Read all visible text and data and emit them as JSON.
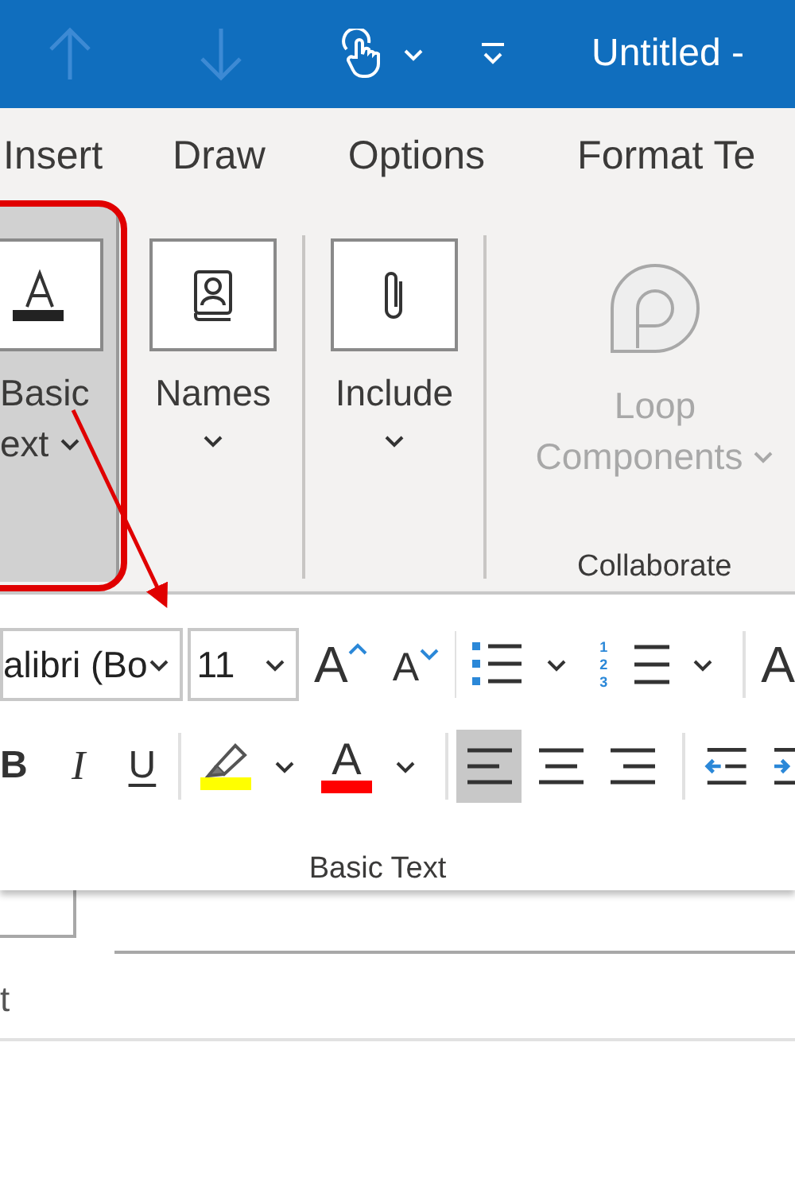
{
  "window": {
    "title": "Untitled -"
  },
  "quick_access": [
    {
      "kind": "up",
      "disabled": true
    },
    {
      "kind": "down",
      "disabled": true
    },
    {
      "kind": "touch",
      "disabled": false
    },
    {
      "kind": "customize",
      "disabled": false
    }
  ],
  "tabs": [
    {
      "label": "Insert"
    },
    {
      "label": "Draw"
    },
    {
      "label": "Options"
    },
    {
      "label": "Format Te"
    }
  ],
  "ribbon": {
    "buttons": [
      {
        "kind": "text",
        "lines": [
          "Basic",
          "ext"
        ],
        "selected": true,
        "disabled": false
      },
      {
        "kind": "names",
        "lines": [
          "Names"
        ],
        "selected": false,
        "disabled": false
      },
      {
        "kind": "include",
        "lines": [
          "Include"
        ],
        "selected": false,
        "disabled": false
      },
      {
        "kind": "loop",
        "lines": [
          "Loop",
          "Components"
        ],
        "selected": false,
        "disabled": true
      }
    ],
    "group_label": "Collaborate"
  },
  "basic_text_panel": {
    "row_1": [
      {
        "kind": "font",
        "value": "alibri (Bo"
      },
      {
        "kind": "size",
        "value": "11"
      },
      {
        "kind": "grow",
        "label": "A"
      },
      {
        "kind": "shrink",
        "label": "A"
      },
      {
        "kind": "separator"
      },
      {
        "kind": "bullets"
      },
      {
        "kind": "numbering",
        "numbers": [
          "1",
          "2",
          "3"
        ]
      },
      {
        "kind": "separator"
      },
      {
        "kind": "styles",
        "label": "A"
      }
    ],
    "row_2": [
      {
        "kind": "bold",
        "label": "B"
      },
      {
        "kind": "italic",
        "label": "I"
      },
      {
        "kind": "underline",
        "label": "U"
      },
      {
        "kind": "separator"
      },
      {
        "kind": "highlight",
        "color": "#ffff00"
      },
      {
        "kind": "font_color",
        "label": "A",
        "color": "#ff0000"
      },
      {
        "kind": "separator"
      },
      {
        "kind": "align_left",
        "selected": true
      },
      {
        "kind": "align_center",
        "selected": false
      },
      {
        "kind": "align_right",
        "selected": false
      },
      {
        "kind": "separator"
      },
      {
        "kind": "outdent"
      },
      {
        "kind": "indent"
      }
    ],
    "group_label": "Basic Text"
  },
  "document": {
    "field_text": "t"
  }
}
